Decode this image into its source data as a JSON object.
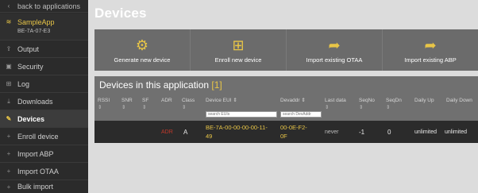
{
  "sidebar": {
    "back_label": "back to applications",
    "app_name": "SampleApp",
    "app_eui": "BE-7A-07-E3",
    "items": [
      {
        "label": "Output",
        "icon": "upload-icon"
      },
      {
        "label": "Security",
        "icon": "lock-icon"
      },
      {
        "label": "Log",
        "icon": "log-icon"
      },
      {
        "label": "Downloads",
        "icon": "download-icon"
      },
      {
        "label": "Devices",
        "icon": "devices-icon",
        "active": true
      }
    ],
    "subitems": [
      {
        "label": "Enroll device"
      },
      {
        "label": "Import ABP"
      },
      {
        "label": "Import OTAA"
      },
      {
        "label": "Bulk import"
      }
    ]
  },
  "main": {
    "title": "Devices",
    "actions": [
      {
        "label": "Generate new device",
        "icon": "gears-icon"
      },
      {
        "label": "Enroll new device",
        "icon": "plus-icon"
      },
      {
        "label": "Import existing OTAA",
        "icon": "share-arrow-icon"
      },
      {
        "label": "Import existing ABP",
        "icon": "share-arrow-icon"
      }
    ],
    "devices_heading": "Devices in this application",
    "devices_count": "[1]",
    "columns": {
      "rssi": "RSSI",
      "snr": "SNR",
      "sf": "SF",
      "adr": "ADR",
      "class": "Class",
      "device_eui": "Device EUI",
      "devaddr": "Devaddr",
      "last_data": "Last data",
      "seqno": "SeqNo",
      "seqdn": "SeqDn",
      "daily_up": "Daily Up",
      "daily_down": "Daily Down"
    },
    "search": {
      "eui_placeholder": "search EUIs",
      "devaddr_placeholder": "search DevAddr"
    },
    "device": {
      "adr": "ADR",
      "class": "A",
      "eui_line1": "BE-7A-00-00-00-00-11-",
      "eui_line2": "49",
      "devaddr_line1": "00-0E-F2-",
      "devaddr_line2": "0F",
      "last_data": "never",
      "seqno": "-1",
      "seqdn": "0",
      "daily_up": "unlimited",
      "daily_down": "unlimited"
    }
  },
  "colors": {
    "sidebar_bg": "#2b2b2b",
    "accent": "#e8c547",
    "panel_bg": "#6b6b6b",
    "adr_red": "#c0392b"
  }
}
